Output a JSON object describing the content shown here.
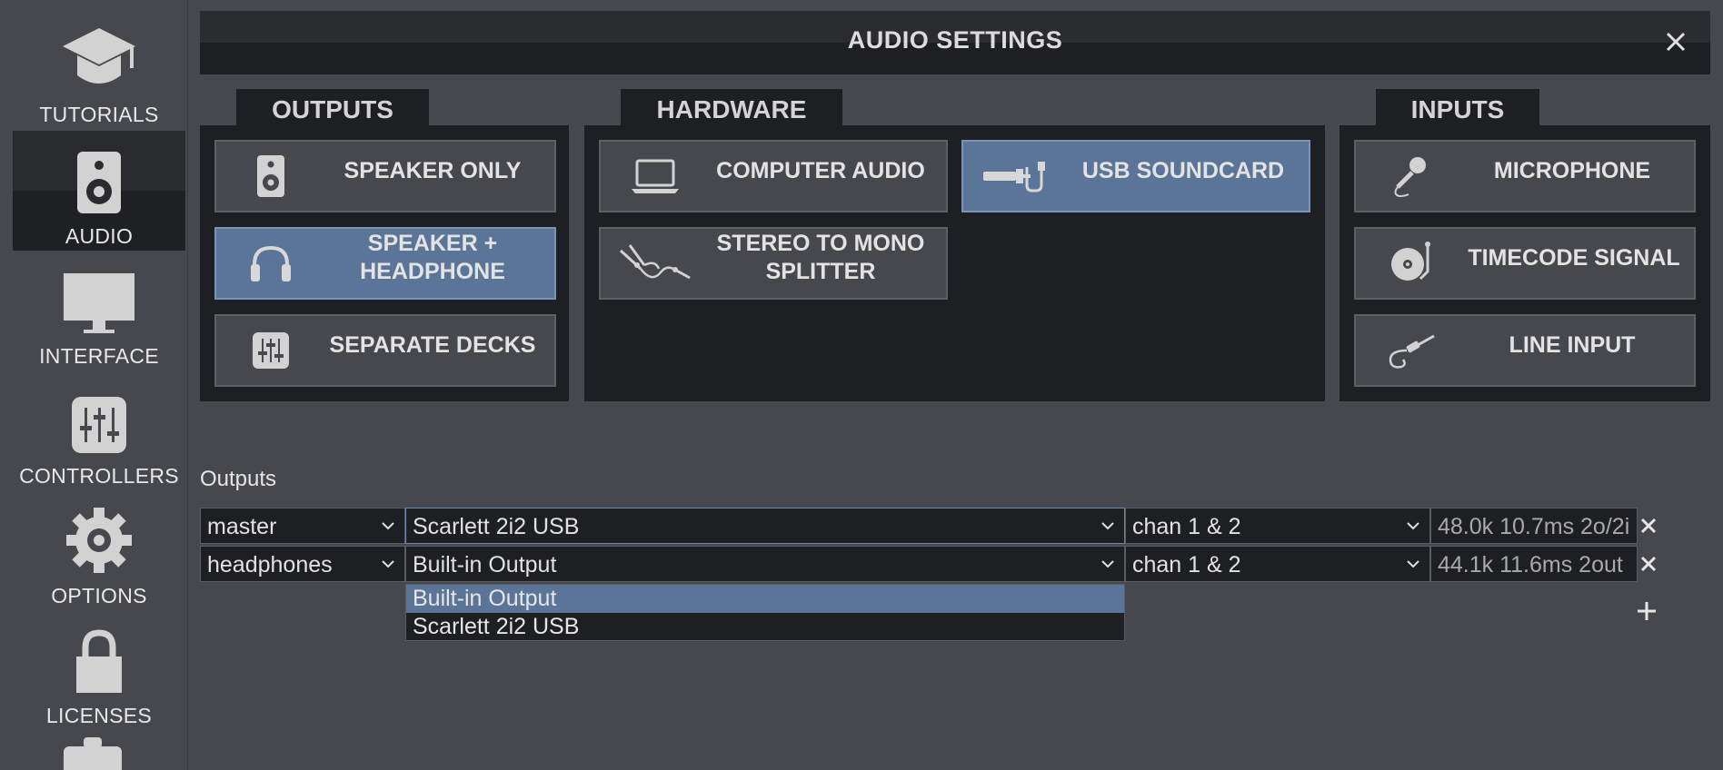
{
  "sidebar": {
    "items": [
      {
        "label": "TUTORIALS",
        "icon": "graduation-cap-icon"
      },
      {
        "label": "AUDIO",
        "icon": "speaker-icon",
        "active": true
      },
      {
        "label": "INTERFACE",
        "icon": "monitor-icon"
      },
      {
        "label": "CONTROLLERS",
        "icon": "sliders-icon"
      },
      {
        "label": "OPTIONS",
        "icon": "gear-icon"
      },
      {
        "label": "LICENSES",
        "icon": "lock-icon"
      },
      {
        "label": "",
        "icon": "briefcase-icon"
      }
    ]
  },
  "window": {
    "title": "AUDIO SETTINGS",
    "close_icon": "close-icon"
  },
  "outputs_panel": {
    "tab": "OUTPUTS",
    "options": [
      {
        "label": "SPEAKER ONLY",
        "icon": "speaker-icon",
        "selected": false
      },
      {
        "label": "SPEAKER +\nHEADPHONE",
        "icon": "headphones-icon",
        "selected": true
      },
      {
        "label": "SEPARATE DECKS",
        "icon": "mixer-icon",
        "selected": false
      }
    ]
  },
  "hardware_panel": {
    "tab": "HARDWARE",
    "options": [
      {
        "label": "COMPUTER AUDIO",
        "icon": "laptop-icon",
        "selected": false
      },
      {
        "label": "USB SOUNDCARD",
        "icon": "usb-cable-icon",
        "selected": true
      },
      {
        "label": "STEREO TO MONO\nSPLITTER",
        "icon": "splitter-cable-icon",
        "selected": false
      }
    ]
  },
  "inputs_panel": {
    "tab": "INPUTS",
    "options": [
      {
        "label": "MICROPHONE",
        "icon": "microphone-icon",
        "selected": false
      },
      {
        "label": "TIMECODE SIGNAL",
        "icon": "turntable-icon",
        "selected": false
      },
      {
        "label": "LINE INPUT",
        "icon": "jack-cable-icon",
        "selected": false
      }
    ]
  },
  "outputs_table": {
    "label": "Outputs",
    "rows": [
      {
        "name": "master",
        "device": "Scarlett 2i2 USB",
        "channels": "chan 1 & 2",
        "info": "48.0k 10.7ms 2o/2i"
      },
      {
        "name": "headphones",
        "device": "Built-in Output",
        "channels": "chan 1 & 2",
        "info": "44.1k 11.6ms 2out"
      }
    ],
    "add_label": "+",
    "remove_label": "×"
  },
  "device_dropdown": {
    "options": [
      "Built-in Output",
      "Scarlett 2i2 USB"
    ],
    "selected": "Built-in Output"
  },
  "colors": {
    "background": "#46484d",
    "panel": "#1e1f22",
    "selected": "#5a7598",
    "text": "#e3e3e3"
  }
}
